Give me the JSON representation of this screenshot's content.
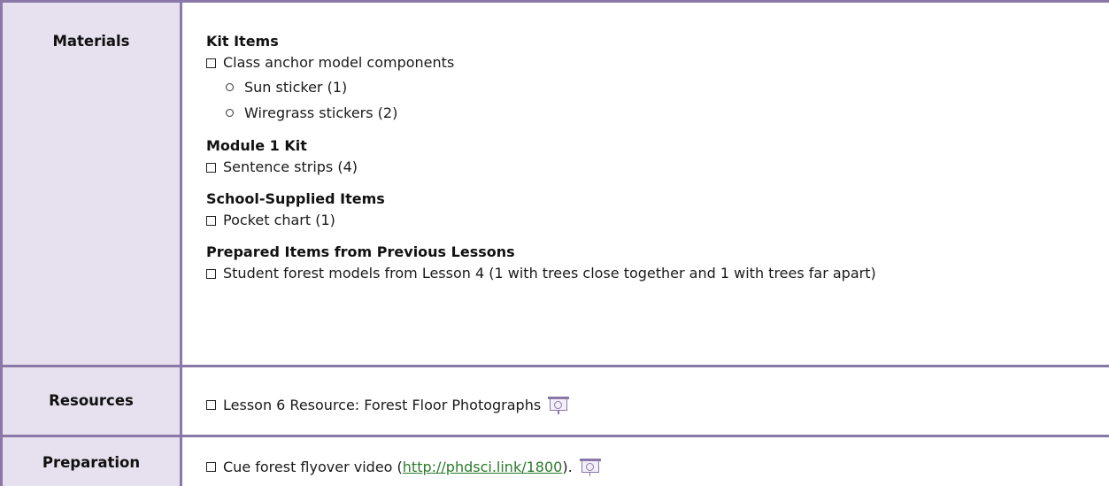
{
  "rows": {
    "materials": {
      "label": "Materials",
      "groups": [
        {
          "heading": "Kit Items",
          "items": [
            {
              "text": "Class anchor model components",
              "subitems": [
                "Sun sticker (1)",
                "Wiregrass stickers (2)"
              ]
            }
          ]
        },
        {
          "heading": "Module 1 Kit",
          "items": [
            {
              "text": "Sentence strips (4)"
            }
          ]
        },
        {
          "heading": "School-Supplied Items",
          "items": [
            {
              "text": "Pocket chart (1)"
            }
          ]
        },
        {
          "heading": "Prepared Items from Previous Lessons",
          "items": [
            {
              "text": "Student forest models from Lesson 4 (1 with trees close together and 1 with trees far apart)"
            }
          ]
        }
      ]
    },
    "resources": {
      "label": "Resources",
      "item": "Lesson 6 Resource: Forest Floor Photographs",
      "icon": "projector-icon"
    },
    "preparation": {
      "label": "Preparation",
      "item_prefix": "Cue forest flyover video (",
      "link": "http://phdsci.link/1800",
      "item_suffix": ").",
      "icon": "projector-icon"
    }
  },
  "colors": {
    "accent": "#8a78a8",
    "label_bg": "#e7e1ef",
    "link": "#2a7a2a"
  }
}
